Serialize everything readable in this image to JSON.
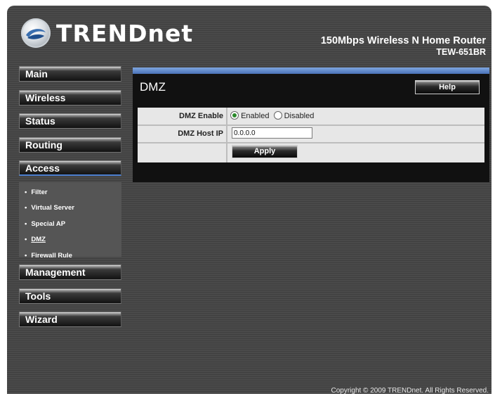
{
  "header": {
    "brand": "TRENDnet",
    "product_line": "150Mbps Wireless N Home Router",
    "model": "TEW-651BR"
  },
  "sidebar": {
    "items": [
      {
        "label": "Main"
      },
      {
        "label": "Wireless"
      },
      {
        "label": "Status"
      },
      {
        "label": "Routing"
      },
      {
        "label": "Access",
        "active": true
      },
      {
        "label": "Management"
      },
      {
        "label": "Tools"
      },
      {
        "label": "Wizard"
      }
    ],
    "access_submenu": [
      {
        "label": "Filter"
      },
      {
        "label": "Virtual Server"
      },
      {
        "label": "Special AP"
      },
      {
        "label": "DMZ",
        "current": true
      },
      {
        "label": "Firewall Rule"
      }
    ]
  },
  "page": {
    "title": "DMZ",
    "help_label": "Help",
    "dmz_enable": {
      "label": "DMZ Enable",
      "options": [
        "Enabled",
        "Disabled"
      ],
      "selected": "Enabled"
    },
    "dmz_host_ip": {
      "label": "DMZ Host IP",
      "value": "0.0.0.0"
    },
    "apply_label": "Apply"
  },
  "footer": {
    "copyright": "Copyright © 2009 TRENDnet. All Rights Reserved."
  },
  "colors": {
    "accent_blue": "#4d7fd0",
    "radio_selected": "#2c8a2c",
    "form_row_bg": "#e7e7e7"
  }
}
